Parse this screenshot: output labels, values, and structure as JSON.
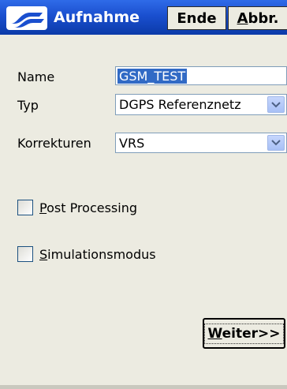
{
  "titlebar": {
    "title": "Aufnahme",
    "logo_icon": "trimble-logo-icon",
    "buttons": {
      "ende": "Ende",
      "abbr_mnemonic": "A",
      "abbr_rest": "bbr."
    }
  },
  "form": {
    "name": {
      "label": "Name",
      "value": "GSM_TEST"
    },
    "typ": {
      "label": "Typ",
      "value": "DGPS Referenznetz"
    },
    "korrekturen": {
      "label": "Korrekturen",
      "value": "VRS"
    }
  },
  "options": {
    "post_processing": {
      "mnemonic": "P",
      "rest": "ost Processing",
      "checked": false
    },
    "simulationsmodus": {
      "mnemonic": "S",
      "rest": "imulationsmodus",
      "checked": false
    }
  },
  "next_button": {
    "mnemonic": "W",
    "rest": "eiter>>"
  },
  "colors": {
    "titlebar": "#1a4fcf",
    "selection": "#316ac5",
    "background": "#ecebe1"
  }
}
